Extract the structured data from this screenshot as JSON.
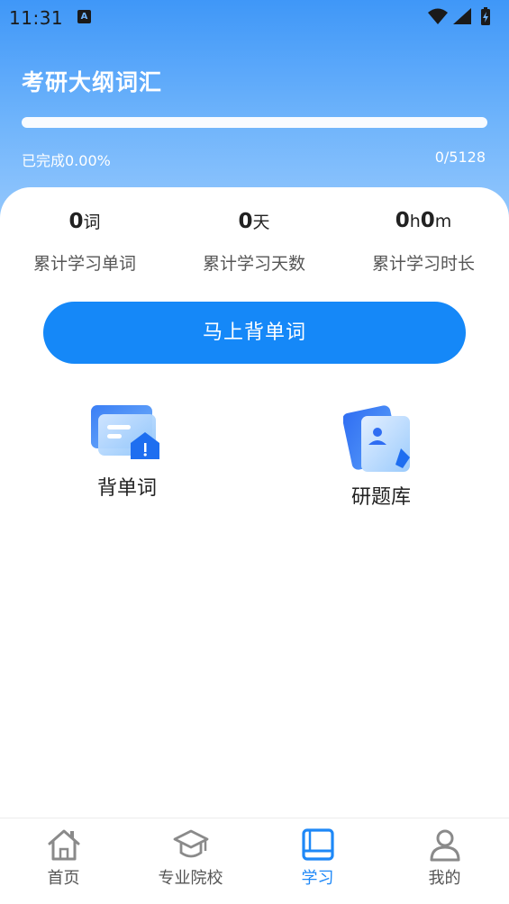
{
  "status_bar": {
    "time": "11:31",
    "notification_icon": "A"
  },
  "header": {
    "title": "考研大纲词汇",
    "progress_text": "已完成0.00%",
    "progress_fraction": 0.0,
    "progress_count": "0/5128"
  },
  "stats": [
    {
      "value": "0",
      "unit": "词",
      "label": "累计学习单词"
    },
    {
      "value": "0",
      "unit": "天",
      "label": "累计学习天数"
    },
    {
      "value_h": "0",
      "unit_h": "h",
      "value_m": "0",
      "unit_m": "m",
      "label": "累计学习时长"
    }
  ],
  "primary_button": "马上背单词",
  "features": [
    {
      "label": "背单词",
      "icon": "flashcard-icon"
    },
    {
      "label": "研题库",
      "icon": "question-bank-icon"
    }
  ],
  "tabbar": {
    "active_color": "#1e88f7",
    "items": [
      {
        "label": "首页",
        "icon": "home-icon"
      },
      {
        "label": "专业院校",
        "icon": "graduation-cap-icon"
      },
      {
        "label": "学习",
        "icon": "book-icon",
        "active": true
      },
      {
        "label": "我的",
        "icon": "user-icon"
      }
    ]
  },
  "colors": {
    "accent": "#1588f8",
    "header_top": "#3f97f8",
    "header_bottom": "#a6d1fd"
  }
}
